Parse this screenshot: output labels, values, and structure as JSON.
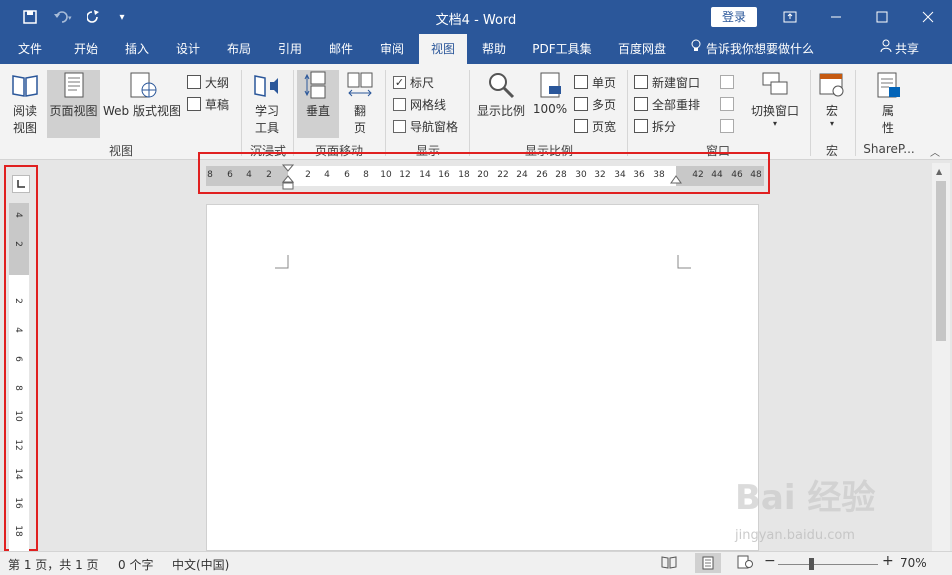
{
  "title": "文档4  -  Word",
  "login": "登录",
  "quick_access": {
    "save": "save-icon",
    "undo": "undo-icon",
    "redo": "redo-icon",
    "customize": "▾"
  },
  "tabs": [
    "文件",
    "开始",
    "插入",
    "设计",
    "布局",
    "引用",
    "邮件",
    "审阅",
    "视图",
    "帮助",
    "PDF工具集",
    "百度网盘"
  ],
  "active_tab": "视图",
  "tell_me": "告诉我你想要做什么",
  "share": "共享",
  "ribbon": {
    "views": {
      "read_mode": "阅读视图",
      "read_mode_l1": "阅读",
      "read_mode_l2": "视图",
      "print_layout": "页面视图",
      "web_layout": "Web 版式视图",
      "outline": "大纲",
      "draft": "草稿",
      "label": "视图"
    },
    "immersive": {
      "learning_l1": "学习",
      "learning_l2": "工具",
      "label": "沉浸式"
    },
    "page_movement": {
      "vertical": "垂直",
      "side_l1": "翻",
      "side_l2": "页",
      "label": "页面移动"
    },
    "show": {
      "ruler": "标尺",
      "ruler_checked": "✓",
      "gridlines": "网格线",
      "nav_pane": "导航窗格",
      "label": "显示"
    },
    "zoom": {
      "zoom": "显示比例",
      "hundred": "100%",
      "one_page": "单页",
      "multi_page": "多页",
      "page_width": "页宽",
      "label": "显示比例"
    },
    "window": {
      "new_window": "新建窗口",
      "arrange_all": "全部重排",
      "split": "拆分",
      "switch_l1": "切换窗口",
      "label": "窗口"
    },
    "macros": {
      "macros": "宏",
      "label": "宏"
    },
    "sharepoint": {
      "properties_l1": "属",
      "properties_l2": "性",
      "label": "ShareP..."
    }
  },
  "h_ruler": [
    "8",
    "6",
    "4",
    "2",
    "2",
    "4",
    "6",
    "8",
    "10",
    "12",
    "14",
    "16",
    "18",
    "20",
    "22",
    "24",
    "26",
    "28",
    "30",
    "32",
    "34",
    "36",
    "38",
    "42",
    "44",
    "46",
    "48"
  ],
  "v_ruler": [
    "4",
    "2",
    "2",
    "4",
    "6",
    "8",
    "10",
    "12",
    "14",
    "16",
    "18"
  ],
  "status": {
    "page": "第 1 页，共 1 页",
    "words": "0 个字",
    "lang": "中文(中国)",
    "zoom": "70%"
  },
  "watermark": {
    "brand": "Bai 经验",
    "url": "jingyan.baidu.com"
  }
}
